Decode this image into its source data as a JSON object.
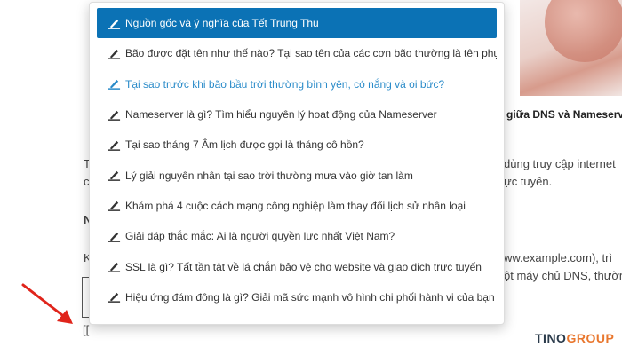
{
  "background": {
    "caption_fragment": "giữa DNS và Nameserver",
    "paragraph_right_1": "dùng truy cập internet",
    "paragraph_right_2": "ực tuyến.",
    "letter_t": "T",
    "letter_c": "c",
    "letter_n": "N",
    "letter_k": "K",
    "paragraph_right_3": "ww.example.com), trì",
    "paragraph_right_4": "ột máy chủ DNS, thường",
    "bracket_text": "[["
  },
  "dropdown": {
    "items": [
      {
        "label": "Nguồn gốc và ý nghĩa của Tết Trung Thu",
        "state": "selected"
      },
      {
        "label": "Bão được đặt tên như thế nào? Tại sao tên của các cơn bão thường là tên phụ nữ?",
        "state": "normal"
      },
      {
        "label": "Tại sao trước khi bão bầu trời thường bình yên, có nắng và oi bức?",
        "state": "hover"
      },
      {
        "label": "Nameserver là gì? Tìm hiểu nguyên lý hoạt động của Nameserver",
        "state": "normal"
      },
      {
        "label": "Tại sao tháng 7 Âm lịch được gọi là tháng cô hồn?",
        "state": "normal"
      },
      {
        "label": "Lý giải nguyên nhân tại sao trời thường mưa vào giờ tan làm",
        "state": "normal"
      },
      {
        "label": "Khám phá 4 cuộc cách mạng công nghiệp làm thay đổi lịch sử nhân loại",
        "state": "normal"
      },
      {
        "label": "Giải đáp thắc mắc: Ai là người quyền lực nhất Việt Nam?",
        "state": "normal"
      },
      {
        "label": "SSL là gì? Tất tần tật về lá chắn bảo vệ cho website và giao dịch trực tuyến",
        "state": "normal"
      },
      {
        "label": "Hiệu ứng đám đông là gì? Giải mã sức mạnh vô hình chi phối hành vi của bạn",
        "state": "normal"
      }
    ],
    "item_icon": "post-edit-icon"
  },
  "brand": {
    "part1": "TINO",
    "part2": "GROUP"
  },
  "colors": {
    "selected_bg": "#0b72b5",
    "hover_text": "#2a8bc9",
    "arrow": "#e0241b",
    "brand_orange": "#e9772e"
  }
}
